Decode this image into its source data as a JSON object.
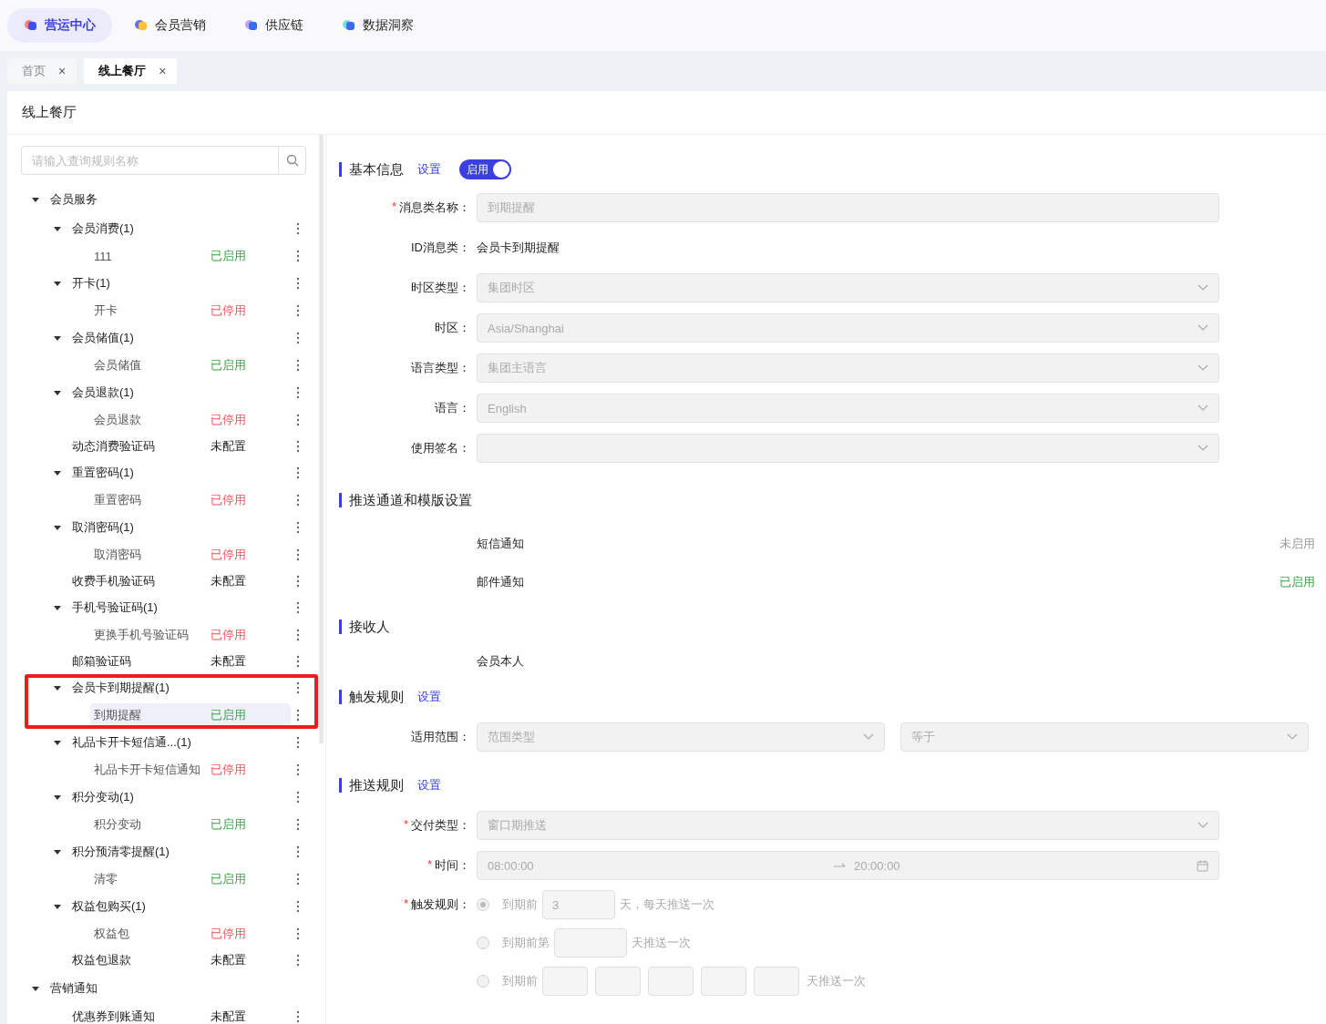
{
  "top_nav": [
    {
      "label": "营运中心",
      "selected": true
    },
    {
      "label": "会员营销",
      "selected": false
    },
    {
      "label": "供应链",
      "selected": false
    },
    {
      "label": "数据洞察",
      "selected": false
    }
  ],
  "tabs": [
    {
      "label": "首页",
      "selected": false,
      "close": "×"
    },
    {
      "label": "线上餐厅",
      "selected": true,
      "close": "×"
    }
  ],
  "page_title": "线上餐厅",
  "search": {
    "placeholder": "请输入查询规则名称"
  },
  "tree": [
    {
      "label": "会员服务",
      "expanded": true,
      "children": [
        {
          "label": "会员消费(1)",
          "expanded": true,
          "selected": false,
          "children": [
            {
              "label": "111",
              "status": "已启用",
              "color": "#3aa544",
              "selected": false
            }
          ]
        },
        {
          "label": "开卡(1)",
          "expanded": true,
          "selected": false,
          "children": [
            {
              "label": "开卡",
              "status": "已停用",
              "color": "#f0535a",
              "selected": false
            }
          ]
        },
        {
          "label": "会员储值(1)",
          "expanded": true,
          "selected": false,
          "children": [
            {
              "label": "会员储值",
              "status": "已启用",
              "color": "#3aa544",
              "selected": false
            }
          ]
        },
        {
          "label": "会员退款(1)",
          "expanded": true,
          "selected": false,
          "children": [
            {
              "label": "会员退款",
              "status": "已停用",
              "color": "#f0535a",
              "selected": false
            }
          ]
        },
        {
          "label": "动态消费验证码",
          "status": "未配置",
          "color": "#222222",
          "selected": false
        },
        {
          "label": "重置密码(1)",
          "expanded": true,
          "selected": false,
          "children": [
            {
              "label": "重置密码",
              "status": "已停用",
              "color": "#f0535a",
              "selected": false
            }
          ]
        },
        {
          "label": "取消密码(1)",
          "expanded": true,
          "selected": false,
          "children": [
            {
              "label": "取消密码",
              "status": "已停用",
              "color": "#f0535a",
              "selected": false
            }
          ]
        },
        {
          "label": "收费手机验证码",
          "status": "未配置",
          "color": "#222222",
          "selected": false
        },
        {
          "label": "手机号验证码(1)",
          "expanded": true,
          "selected": false,
          "children": [
            {
              "label": "更换手机号验证码",
              "status": "已停用",
              "color": "#f0535a",
              "selected": false
            }
          ]
        },
        {
          "label": "邮箱验证码",
          "status": "未配置",
          "color": "#222222",
          "selected": false
        },
        {
          "label": "会员卡到期提醒(1)",
          "expanded": true,
          "selected": false,
          "highlighted": true,
          "children": [
            {
              "label": "到期提醒",
              "status": "已启用",
              "color": "#3aa544",
              "selected": true
            }
          ]
        },
        {
          "label": "礼品卡开卡短信通...(1)",
          "expanded": true,
          "selected": false,
          "children": [
            {
              "label": "礼品卡开卡短信通知",
              "status": "已停用",
              "color": "#f0535a",
              "selected": false
            }
          ]
        },
        {
          "label": "积分变动(1)",
          "expanded": true,
          "selected": false,
          "children": [
            {
              "label": "积分变动",
              "status": "已启用",
              "color": "#3aa544",
              "selected": false
            }
          ]
        },
        {
          "label": "积分预清零提醒(1)",
          "expanded": true,
          "selected": false,
          "children": [
            {
              "label": "清零",
              "status": "已启用",
              "color": "#3aa544",
              "selected": false
            }
          ]
        },
        {
          "label": "权益包购买(1)",
          "expanded": true,
          "selected": false,
          "children": [
            {
              "label": "权益包",
              "status": "已停用",
              "color": "#f0535a",
              "selected": false
            }
          ]
        },
        {
          "label": "权益包退款",
          "status": "未配置",
          "color": "#222222",
          "selected": false
        }
      ]
    },
    {
      "label": "营销通知",
      "expanded": true,
      "children": [
        {
          "label": "优惠券到账通知",
          "status": "未配置",
          "color": "#222222",
          "selected": false
        }
      ]
    }
  ],
  "basic": {
    "title": "基本信息",
    "link": "设置",
    "toggle": {
      "label": "启用",
      "on": true
    },
    "fields": [
      {
        "label": "消息类名称：",
        "mark": "*",
        "kind": "input",
        "value": "到期提醒",
        "disabled": true
      },
      {
        "label": "ID消息类：",
        "kind": "text",
        "value": "会员卡到期提醒"
      },
      {
        "label": "时区类型：",
        "kind": "select",
        "value": "集团时区",
        "disabled": true
      },
      {
        "label": "时区：",
        "kind": "select",
        "value": "Asia/Shanghai",
        "disabled": true
      },
      {
        "label": "语言类型：",
        "kind": "select",
        "value": "集团主语言",
        "disabled": true
      },
      {
        "label": "语言：",
        "kind": "select",
        "value": "English",
        "disabled": true
      },
      {
        "label": "使用签名：",
        "kind": "select",
        "disabled": true
      }
    ]
  },
  "channels": {
    "title": "推送通道和模版设置",
    "items": [
      {
        "name": "短信通知",
        "status": "未启用",
        "enabled": false
      },
      {
        "name": "邮件通知",
        "status": "已启用",
        "enabled": true
      }
    ]
  },
  "recipients": {
    "title": "接收人",
    "items": [
      "会员本人"
    ]
  },
  "trigger": {
    "title": "触发规则",
    "link": "设置",
    "scope": {
      "label": "适用范围：",
      "selects": [
        "范围类型",
        "等于"
      ]
    }
  },
  "push": {
    "title": "推送规则",
    "link": "设置",
    "delivery": {
      "label": "交付类型：",
      "mark": "*",
      "value": "窗口期推送"
    },
    "time": {
      "label": "时间：",
      "mark": "*",
      "start": "08:00:00",
      "end": "20:00:00"
    },
    "rule": {
      "label": "触发规则：",
      "mark": "*",
      "options": [
        {
          "selected": true,
          "prefix": "到期前",
          "boxes": [
            {
              "kind": "wide",
              "value": "3"
            }
          ],
          "suffix": "天，每天推送一次"
        },
        {
          "selected": false,
          "prefix": "到期前第",
          "boxes": [
            {
              "kind": "wide"
            }
          ],
          "suffix": "天推送一次"
        },
        {
          "selected": false,
          "prefix": "到期前",
          "boxes": [
            {
              "kind": "small"
            },
            {
              "kind": "small"
            },
            {
              "kind": "small"
            },
            {
              "kind": "small"
            },
            {
              "kind": "small"
            }
          ],
          "suffix": "天推送一次"
        }
      ]
    }
  }
}
